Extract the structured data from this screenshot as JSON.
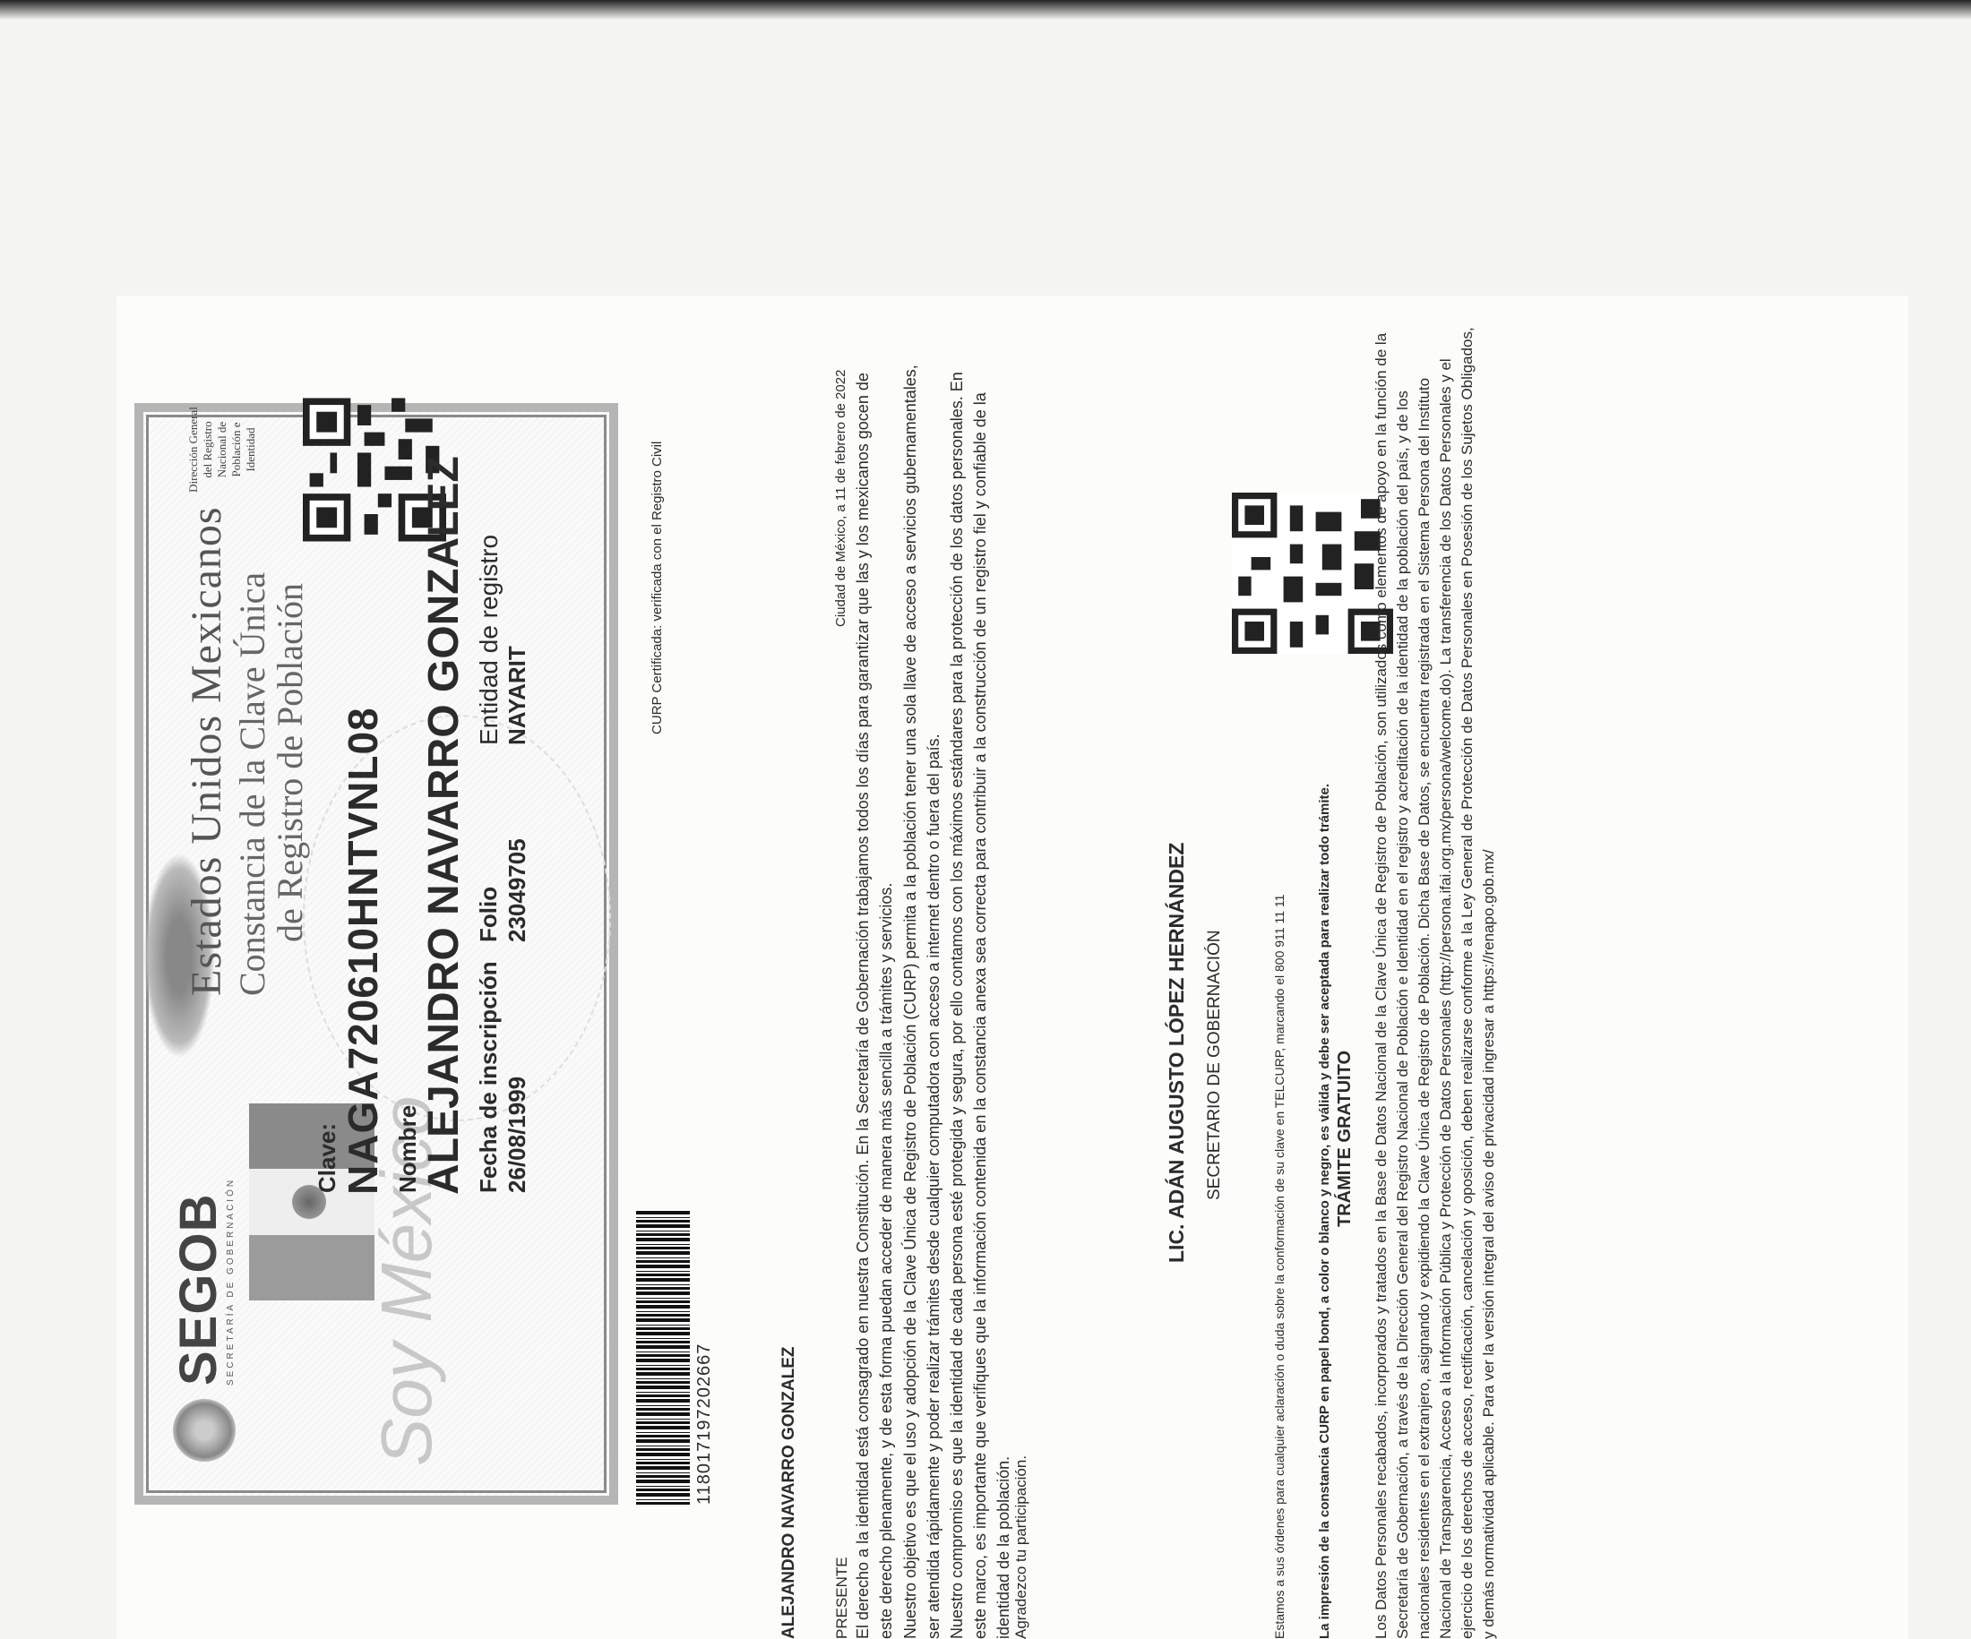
{
  "header": {
    "segob": "SEGOB",
    "segob_sub": "SECRETARÍA DE GOBERNACIÓN",
    "soy_mexico": "Soy México",
    "title1": "Estados Unidos Mexicanos",
    "title2": "Constancia de la Clave Única",
    "title3": "de Registro de Población",
    "dir_general": "Dirección General del Registro Nacional de Población e Identidad"
  },
  "fields": {
    "clave_label": "Clave:",
    "clave": "NAGA720610HNTVNL08",
    "nombre_label": "Nombre",
    "nombre": "ALEJANDRO NAVARRO GONZALEZ",
    "fecha_label": "Fecha de inscripción",
    "fecha": "26/08/1999",
    "folio_label": "Folio",
    "folio": "23049705",
    "entidad_label": "Entidad de registro",
    "entidad": "NAYARIT"
  },
  "barcode_number": "118017197202667",
  "certificada": "CURP Certificada: verificada con el Registro Civil",
  "letter": {
    "addressee": "ALEJANDRO NAVARRO GONZALEZ",
    "presente": "PRESENTE",
    "city_date": "Ciudad de México, a 11 de febrero de 2022",
    "p1": "El derecho a la identidad está consagrado en nuestra Constitución. En la Secretaría de Gobernación trabajamos todos los días para garantizar que las y los mexicanos gocen de este derecho plenamente, y de esta forma puedan acceder de manera más sencilla a trámites y servicios.",
    "p2": "Nuestro objetivo es que el uso y adopción de la Clave Única de Registro de Población (CURP) permita a la población tener una sola llave de acceso a servicios gubernamentales, ser atendida rápidamente y poder realizar trámites desde cualquier computadora con acceso a internet dentro o fuera del país.",
    "p3": "Nuestro compromiso es que la identidad de cada persona esté protegida y segura, por ello contamos con los máximos estándares para la protección de los datos personales. En este marco, es importante que verifiques que la información contenida en la constancia anexa sea correcta para contribuir a la construcción de un registro fiel y confiable de la identidad de la población.",
    "agradezco": "Agradezco tu participación.",
    "firmante": "LIC. ADÁN AUGUSTO LÓPEZ HERNÁNDEZ",
    "cargo": "SECRETARIO DE GOBERNACIÓN",
    "ordenes": "Estamos a sus órdenes para cualquier aclaración o duda sobre la conformación de su clave en TELCURP, marcando el 800 911 11 11",
    "impresion": "La impresión de la constancia CURP en papel bond, a color o blanco y negro, es válida y debe ser aceptada para realizar todo trámite.",
    "gratuito": "TRÁMITE GRATUITO",
    "p4": "Los Datos Personales recabados, incorporados y tratados en la Base de Datos Nacional de la Clave Única de Registro de Población, son utilizados como elementos de apoyo en la función de la Secretaría de Gobernación, a través de la Dirección General del Registro Nacional de Población e Identidad en el registro y acreditación de la identidad de la población del país, y de los nacionales residentes en el extranjero, asignando y expidiendo la Clave Única de Registro de Población. Dicha Base de Datos, se encuentra registrada en el Sistema Persona del Instituto Nacional de Transparencia, Acceso a la Información Pública y Protección de Datos Personales (http://persona.ifai.org.mx/persona/welcome.do). La transferencia de los Datos Personales y el ejercicio de los derechos de acceso, rectificación, cancelación y oposición, deben realizarse conforme a la Ley General de Protección de Datos Personales en Posesión de los Sujetos Obligados, y demás normatividad aplicable. Para ver la versión integral del aviso de privacidad ingresar a https://renapo.gob.mx/"
  }
}
